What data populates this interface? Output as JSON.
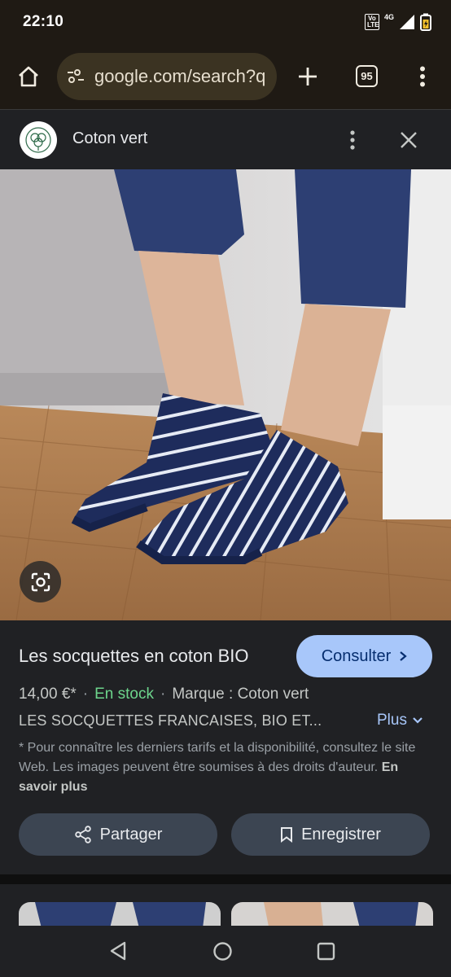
{
  "status": {
    "time": "22:10",
    "volte_label": "Vo LTE",
    "network_label": "4G"
  },
  "browser": {
    "url": "google.com/search?q",
    "tab_count": "95"
  },
  "sheet": {
    "site_name": "Coton vert"
  },
  "product": {
    "title": "Les socquettes en coton BIO",
    "consult_label": "Consulter",
    "price": "14,00 €*",
    "availability": "En stock",
    "brand": "Marque : Coton vert",
    "description": "LES SOCQUETTES FRANCAISES, BIO ET...",
    "more_label": "Plus",
    "disclaimer": "* Pour connaître les derniers tarifs et la disponibilité, consultez le site Web. Les images peuvent être soumises à des droits d'auteur.",
    "learn_more": "En savoir plus",
    "share_label": "Partager",
    "save_label": "Enregistrer"
  },
  "colors": {
    "accent": "#a8c7fa",
    "in_stock": "#6dd58c",
    "surface": "#202124",
    "browser_bar": "#1f1a14"
  }
}
